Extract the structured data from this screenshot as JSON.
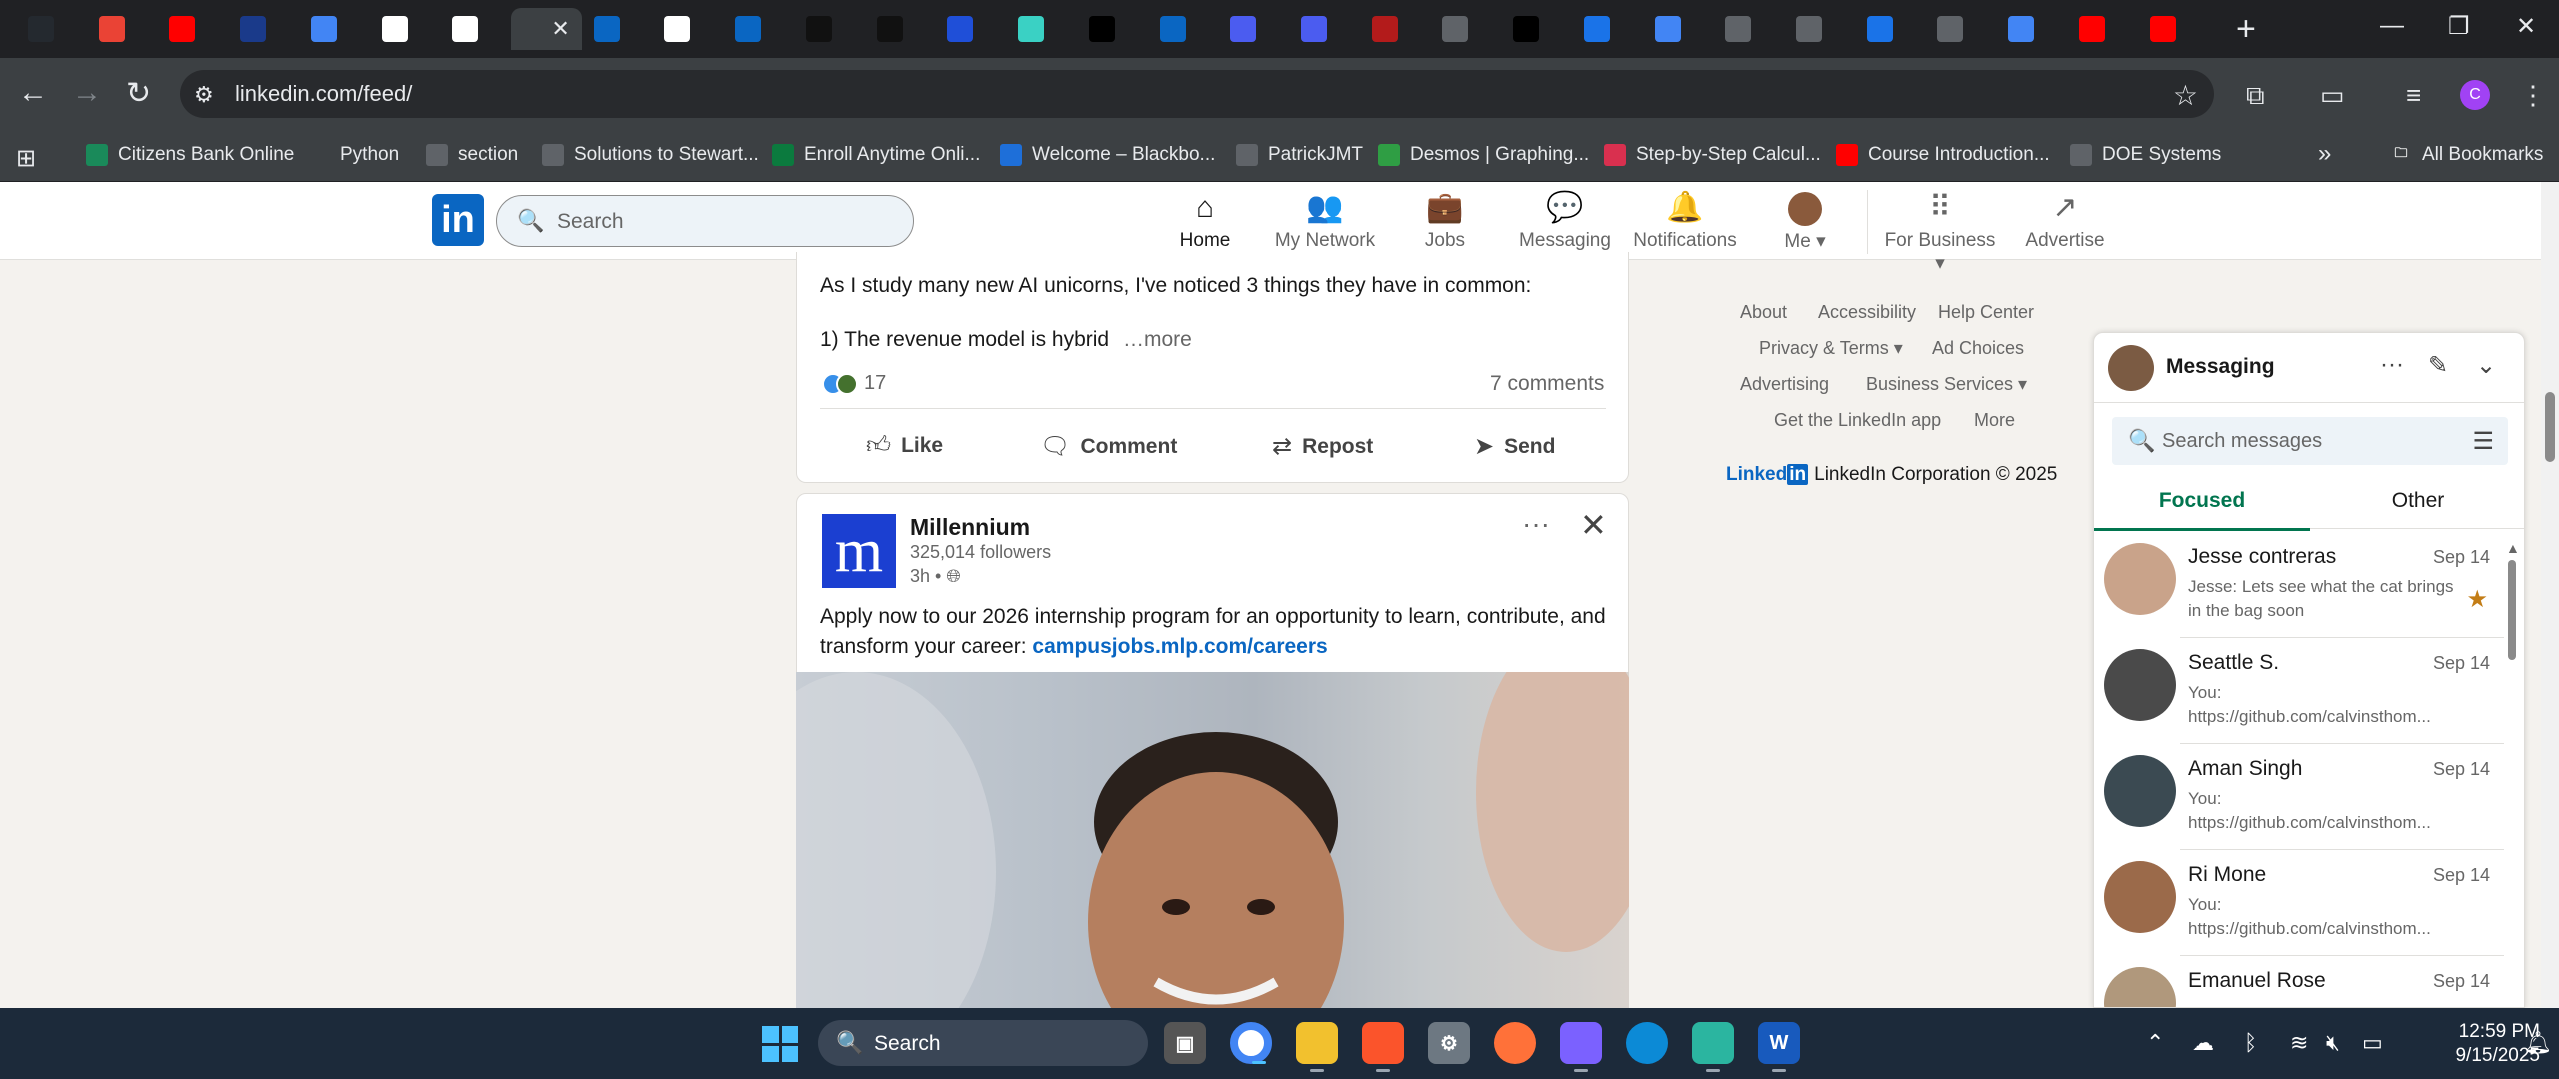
{
  "browser": {
    "active_tab_close": "✕",
    "new_tab": "+",
    "window_controls": {
      "minimize": "—",
      "maximize": "❐",
      "close": "✕"
    },
    "url": "linkedin.com/feed/",
    "nav_icons": {
      "back": "back-icon",
      "forward": "forward-icon",
      "reload": "reload-icon",
      "site_info": "site-info-icon",
      "bookmark": "star-icon"
    },
    "profile_letter": "C",
    "bookmarks": [
      {
        "label": "Citizens Bank Online",
        "icon": "citizens-bank-icon",
        "color": "#1a8a5a"
      },
      {
        "label": "Python",
        "icon": "folder-icon",
        "color": "#3c4043"
      },
      {
        "label": "section",
        "icon": "globe-icon",
        "color": "#5f6368"
      },
      {
        "label": "Solutions to Stewart...",
        "icon": "globe-icon",
        "color": "#5f6368"
      },
      {
        "label": "Enroll Anytime Onli...",
        "icon": "und-icon",
        "color": "#0b7a3e"
      },
      {
        "label": "Welcome – Blackbo...",
        "icon": "blackboard-icon",
        "color": "#1e6fd9"
      },
      {
        "label": "PatrickJMT",
        "icon": "globe-icon",
        "color": "#5f6368"
      },
      {
        "label": "Desmos | Graphing...",
        "icon": "desmos-icon",
        "color": "#2f9e44"
      },
      {
        "label": "Step-by-Step Calcul...",
        "icon": "symbolab-icon",
        "color": "#d9304f"
      },
      {
        "label": "Course Introduction...",
        "icon": "youtube-icon",
        "color": "#ff0000"
      },
      {
        "label": "DOE Systems",
        "icon": "doe-icon",
        "color": "#5f6368"
      }
    ],
    "all_bookmarks": "All Bookmarks",
    "overflow": "»"
  },
  "linkedin": {
    "search_placeholder": "Search",
    "nav": [
      {
        "label": "Home",
        "icon": "home-icon",
        "glyph": "⌂"
      },
      {
        "label": "My Network",
        "icon": "network-icon",
        "glyph": "👥"
      },
      {
        "label": "Jobs",
        "icon": "briefcase-icon",
        "glyph": "💼"
      },
      {
        "label": "Messaging",
        "icon": "chat-icon",
        "glyph": "💬"
      },
      {
        "label": "Notifications",
        "icon": "bell-icon",
        "glyph": "🔔"
      },
      {
        "label": "Me ▾",
        "icon": "avatar-icon",
        "glyph": ""
      },
      {
        "label": "For Business ▾",
        "icon": "grid-icon",
        "glyph": "⠿"
      },
      {
        "label": "Advertise",
        "icon": "advertise-icon",
        "glyph": "↗"
      }
    ]
  },
  "post1": {
    "line1": "As I study many new AI unicorns, I've noticed 3 things they have in common:",
    "line2": "1) The revenue model is hybrid",
    "more": "…more",
    "reaction_count": "17",
    "comments": "7 comments",
    "actions": [
      "Like",
      "Comment",
      "Repost",
      "Send"
    ]
  },
  "post2": {
    "logo_letter": "m",
    "author": "Millennium",
    "followers": "325,014 followers",
    "time": "3h •",
    "text": "Apply now to our 2026 internship program for an opportunity to learn, contribute, and transform your career:",
    "link": "campusjobs.mlp.com/careers",
    "menu": "···",
    "close": "✕"
  },
  "sidebar_links": [
    "About",
    "Accessibility",
    "Help Center",
    "Privacy & Terms ▾",
    "Ad Choices",
    "Advertising",
    "Business Services ▾",
    "Get the LinkedIn app",
    "More"
  ],
  "copyright": {
    "brand": "Linked",
    "in": "in",
    "text": "LinkedIn Corporation © 2025"
  },
  "messaging": {
    "title": "Messaging",
    "search_placeholder": "Search messages",
    "tabs": [
      "Focused",
      "Other"
    ],
    "conversations": [
      {
        "name": "Jesse contreras",
        "date": "Sep 14",
        "preview": "Jesse: Lets see what the cat brings in the bag soon",
        "starred": true
      },
      {
        "name": "Seattle S.",
        "date": "Sep 14",
        "preview": "You:",
        "preview2": "https://github.com/calvinsthom..."
      },
      {
        "name": "Aman Singh",
        "date": "Sep 14",
        "preview": "You:",
        "preview2": "https://github.com/calvinsthom..."
      },
      {
        "name": "Ri Mone",
        "date": "Sep 14",
        "preview": "You:",
        "preview2": "https://github.com/calvinsthom..."
      },
      {
        "name": "Emanuel Rose",
        "date": "Sep 14",
        "preview": "",
        "preview2": ""
      }
    ]
  },
  "taskbar": {
    "search": "Search",
    "time": "12:59 PM",
    "date": "9/15/2025"
  }
}
